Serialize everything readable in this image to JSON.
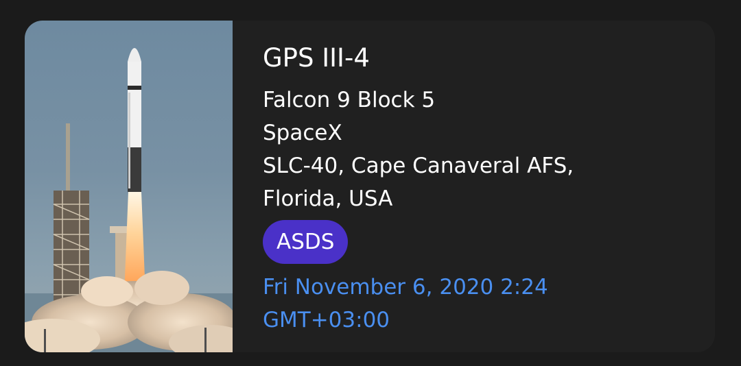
{
  "launch": {
    "name": "GPS III-4",
    "rocket": "Falcon 9 Block 5",
    "provider": "SpaceX",
    "pad_line1": "SLC-40, Cape Canaveral AFS,",
    "pad_line2": "Florida, USA",
    "landing_badge": "ASDS",
    "date_line1": "Fri November 6, 2020 2:24",
    "date_line2": "GMT+03:00"
  },
  "colors": {
    "background": "#1b1b1b",
    "card": "#202020",
    "badge": "#4a31c8",
    "date_text": "#4a8ff0"
  },
  "image": {
    "subject": "rocket-launch-photo"
  }
}
